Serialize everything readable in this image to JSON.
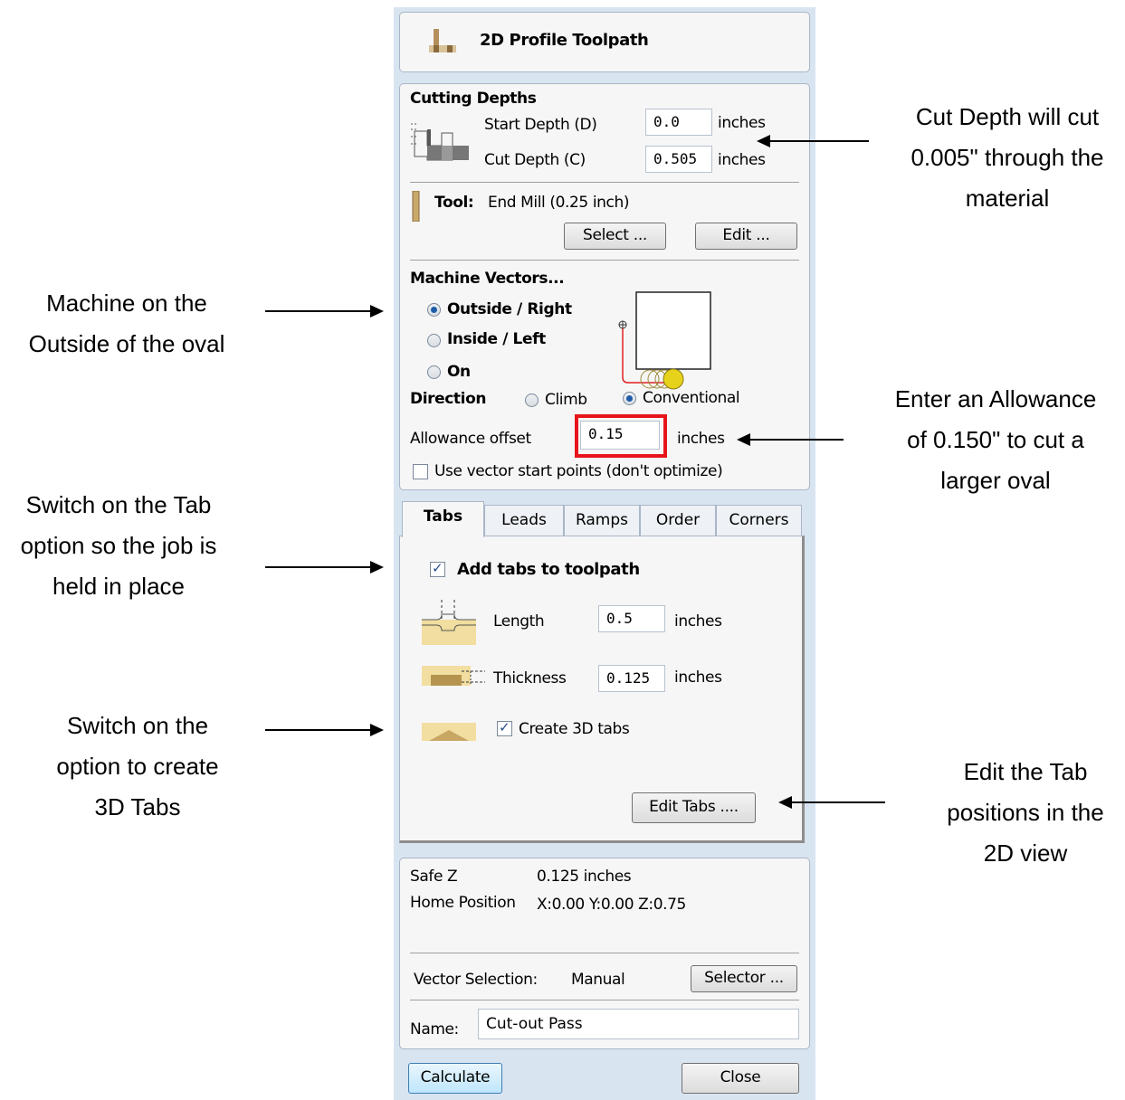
{
  "title": "2D Profile Toolpath",
  "cutting_depths": {
    "heading": "Cutting Depths",
    "start_label": "Start Depth (D)",
    "start_value": "0.0",
    "cut_label": "Cut Depth (C)",
    "cut_value": "0.505",
    "unit": "inches"
  },
  "tool": {
    "label": "Tool:",
    "name": "End Mill (0.25 inch)",
    "select_button": "Select ...",
    "edit_button": "Edit ..."
  },
  "machine_vectors": {
    "heading": "Machine Vectors...",
    "options": [
      "Outside / Right",
      "Inside / Left",
      "On"
    ],
    "selected": "Outside / Right",
    "direction_label": "Direction",
    "direction_options": [
      "Climb",
      "Conventional"
    ],
    "direction_selected": "Conventional",
    "allowance_label": "Allowance offset",
    "allowance_value": "0.15",
    "allowance_unit": "inches",
    "start_points_label": "Use vector start points (don't optimize)",
    "start_points_checked": false
  },
  "tabs": {
    "tab_labels": [
      "Tabs",
      "Leads",
      "Ramps",
      "Order",
      "Corners"
    ],
    "active_tab": "Tabs",
    "add_tabs_label": "Add tabs to toolpath",
    "add_tabs_checked": true,
    "length_label": "Length",
    "length_value": "0.5",
    "thickness_label": "Thickness",
    "thickness_value": "0.125",
    "unit": "inches",
    "create_3d_label": "Create 3D tabs",
    "create_3d_checked": true,
    "edit_tabs_button": "Edit Tabs ...."
  },
  "info": {
    "safe_z_label": "Safe Z",
    "safe_z_value": "0.125 inches",
    "home_label": "Home Position",
    "home_value": "X:0.00 Y:0.00 Z:0.75",
    "vector_selection_label": "Vector Selection:",
    "vector_selection_value": "Manual",
    "selector_button": "Selector ...",
    "name_label": "Name:",
    "name_value": "Cut-out Pass"
  },
  "buttons": {
    "calculate": "Calculate",
    "close": "Close"
  },
  "annotations": {
    "cut_depth": [
      "Cut Depth will cut",
      "0.005\" through the",
      "material"
    ],
    "machine_outside": [
      "Machine on the",
      "Outside of the oval"
    ],
    "allowance": [
      "Enter an Allowance",
      "of 0.150\" to cut a",
      "larger oval"
    ],
    "tab_option": [
      "Switch on the Tab",
      "option so the job is",
      "held in place"
    ],
    "create_3d": [
      "Switch on the",
      "option to create",
      "3D Tabs"
    ],
    "edit_tabs": [
      "Edit the Tab",
      "positions in the",
      "2D view"
    ]
  },
  "colors": {
    "panel_bg": "#d9e4f1",
    "box_bg": "#f6f6f6",
    "highlight": "#e8141c",
    "radio_dot": "#1f5ca8"
  }
}
